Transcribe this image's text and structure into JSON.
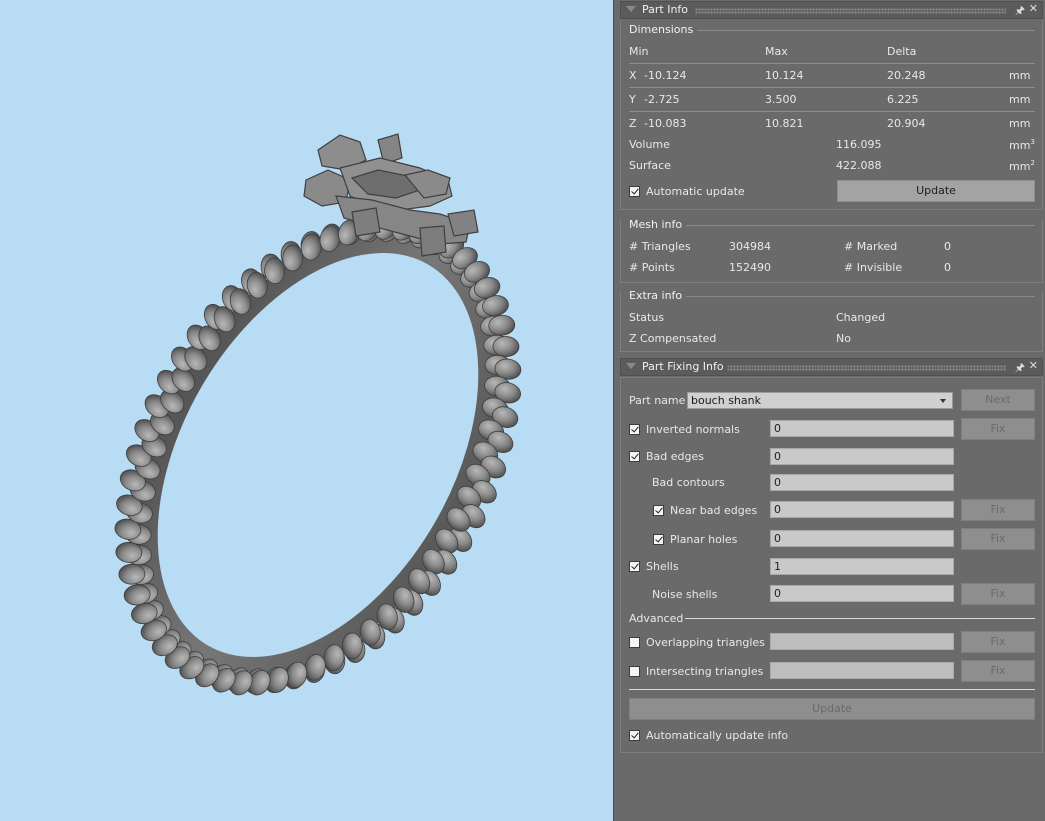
{
  "part_info": {
    "title": "Part Info",
    "dimensions": {
      "label": "Dimensions",
      "headers": [
        "Min",
        "Max",
        "Delta"
      ],
      "rows": [
        {
          "axis": "X",
          "min": "-10.124",
          "max": "10.124",
          "delta": "20.248",
          "unit": "mm"
        },
        {
          "axis": "Y",
          "min": "-2.725",
          "max": "3.500",
          "delta": "6.225",
          "unit": "mm"
        },
        {
          "axis": "Z",
          "min": "-10.083",
          "max": "10.821",
          "delta": "20.904",
          "unit": "mm"
        }
      ],
      "volume_label": "Volume",
      "volume_value": "116.095",
      "volume_unit": "mm",
      "volume_exp": "3",
      "surface_label": "Surface",
      "surface_value": "422.088",
      "surface_unit": "mm",
      "surface_exp": "2",
      "auto_update_label": "Automatic update",
      "auto_update_checked": true,
      "update_button": "Update"
    },
    "mesh_info": {
      "label": "Mesh info",
      "triangles_label": "# Triangles",
      "triangles_value": "304984",
      "points_label": "# Points",
      "points_value": "152490",
      "marked_label": "# Marked",
      "marked_value": "0",
      "invisible_label": "# Invisible",
      "invisible_value": "0"
    },
    "extra_info": {
      "label": "Extra info",
      "status_label": "Status",
      "status_value": "Changed",
      "zcomp_label": "Z Compensated",
      "zcomp_value": "No"
    }
  },
  "part_fixing": {
    "title": "Part Fixing Info",
    "part_name_label": "Part name",
    "part_name_value": "bouch shank",
    "next_button": "Next",
    "fix_label": "Fix",
    "rows": {
      "inverted_normals": {
        "label": "Inverted normals",
        "value": "0",
        "checked": true
      },
      "bad_edges": {
        "label": "Bad edges",
        "value": "0",
        "checked": true
      },
      "bad_contours": {
        "label": "Bad contours",
        "value": "0"
      },
      "near_bad_edges": {
        "label": "Near bad edges",
        "value": "0",
        "checked": true
      },
      "planar_holes": {
        "label": "Planar holes",
        "value": "0",
        "checked": true
      },
      "shells": {
        "label": "Shells",
        "value": "1",
        "checked": true
      },
      "noise_shells": {
        "label": "Noise shells",
        "value": "0"
      },
      "overlapping": {
        "label": "Overlapping triangles",
        "value": "",
        "checked": false
      },
      "intersecting": {
        "label": "Intersecting triangles",
        "value": "",
        "checked": false
      }
    },
    "advanced_label": "Advanced",
    "update_button": "Update",
    "auto_update_label": "Automatically update info",
    "auto_update_checked": true
  },
  "colors": {
    "viewport_bg": "#b9dcf5",
    "panel_bg": "#6a6a6a",
    "model_gray": "#8c8c8c"
  }
}
